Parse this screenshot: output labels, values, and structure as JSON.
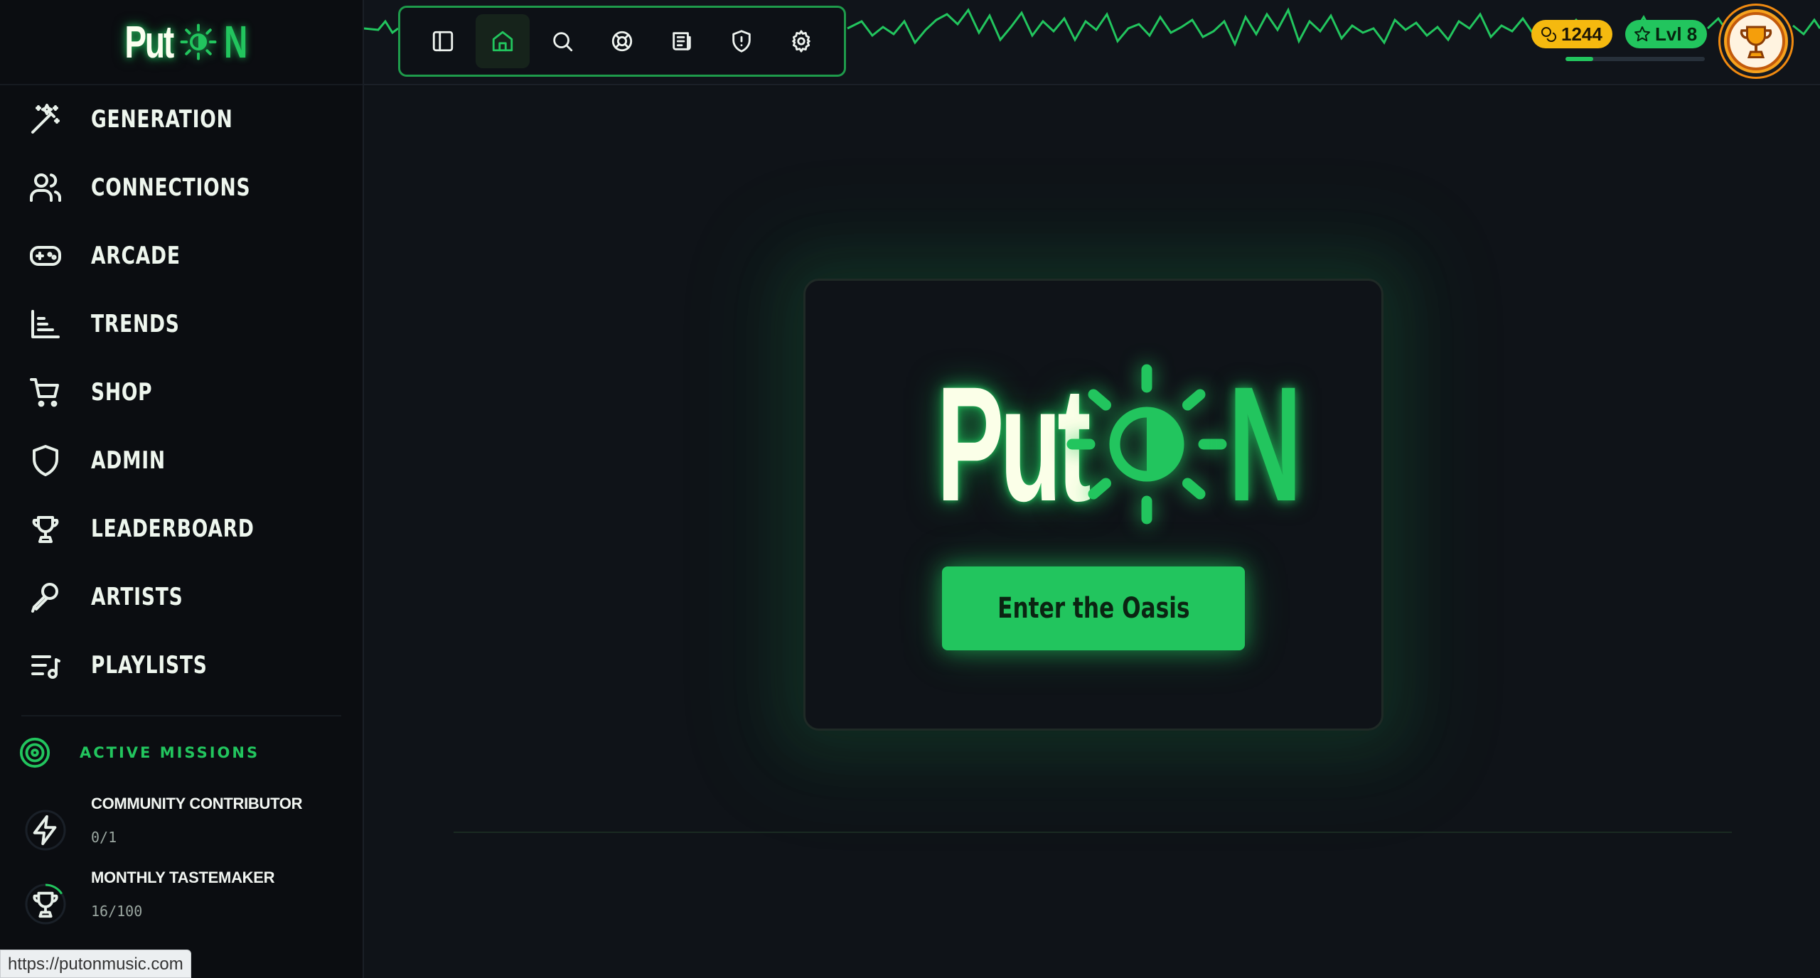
{
  "brand": {
    "put": "Put",
    "n": "N"
  },
  "sidebar": {
    "items": [
      {
        "label": "GENERATION",
        "icon": "magic-wand-icon"
      },
      {
        "label": "CONNECTIONS",
        "icon": "users-icon"
      },
      {
        "label": "ARCADE",
        "icon": "gamepad-icon"
      },
      {
        "label": "TRENDS",
        "icon": "bar-chart-icon"
      },
      {
        "label": "SHOP",
        "icon": "cart-icon"
      },
      {
        "label": "ADMIN",
        "icon": "shield-icon"
      },
      {
        "label": "LEADERBOARD",
        "icon": "trophy-icon"
      },
      {
        "label": "ARTISTS",
        "icon": "microphone-icon"
      },
      {
        "label": "PLAYLISTS",
        "icon": "playlist-icon"
      }
    ],
    "missions": {
      "title": "ACTIVE MISSIONS",
      "items": [
        {
          "title": "COMMUNITY CONTRIBUTOR",
          "progress": "0/1",
          "icon": "lightning-icon",
          "fraction": 0
        },
        {
          "title": "MONTHLY TASTEMAKER",
          "progress": "16/100",
          "icon": "trophy-icon",
          "fraction": 0.16
        }
      ]
    }
  },
  "toolbar": {
    "buttons": [
      {
        "icon": "sidebar-toggle-icon",
        "active": false
      },
      {
        "icon": "home-icon",
        "active": true
      },
      {
        "icon": "search-icon",
        "active": false
      },
      {
        "icon": "lifebuoy-icon",
        "active": false
      },
      {
        "icon": "newspaper-icon",
        "active": false
      },
      {
        "icon": "shield-alert-icon",
        "active": false
      },
      {
        "icon": "gear-icon",
        "active": false
      }
    ]
  },
  "user": {
    "coins": "1244",
    "level": "Lvl 8",
    "xp_fraction": 0.2
  },
  "hero": {
    "put": "Put",
    "n": "N",
    "button_label": "Enter the Oasis"
  },
  "status_url": "https://putonmusic.com",
  "colors": {
    "accent": "#22c55e",
    "background": "#0f1318",
    "sidebar": "#0b0d11",
    "coin": "#f5b90f"
  }
}
